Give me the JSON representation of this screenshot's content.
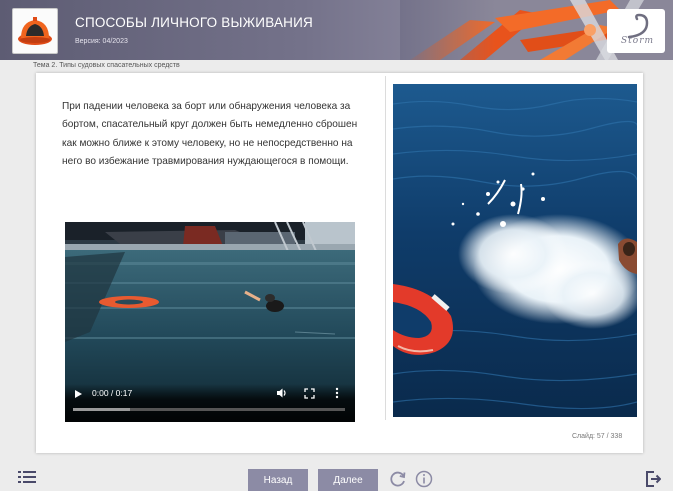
{
  "header": {
    "logo_icon": "liferaft-icon",
    "title": "СПОСОБЫ ЛИЧНОГО ВЫЖИВАНИЯ",
    "version": "Версия: 04/2023",
    "brand_icon": "storm-logo-icon",
    "brand_text": "Storm"
  },
  "breadcrumb": "Тема 2. Типы судовых спасательных средств",
  "content": {
    "text": "При падении человека за борт или обнаружения человека за бортом, спасательный круг должен быть немедленно сброшен как можно ближе к этому человеку, но не непосредственно на него во избежание травмирования нуждающегося в помощи."
  },
  "video": {
    "time": "0:00 / 0:17",
    "buffered_fraction": 0.21,
    "icons": [
      "play-icon",
      "volume-icon",
      "fullscreen-icon",
      "more-options-icon"
    ]
  },
  "slide_counter": "Слайд: 57 / 338",
  "footer": {
    "back_label": "Назад",
    "next_label": "Далее",
    "icons": [
      "menu-list-icon",
      "reload-icon",
      "info-icon",
      "exit-icon"
    ]
  },
  "colors": {
    "header": "#74728a",
    "button": "#8c8ba5",
    "accent_orange": "#f05a1e",
    "background": "#ececec"
  }
}
